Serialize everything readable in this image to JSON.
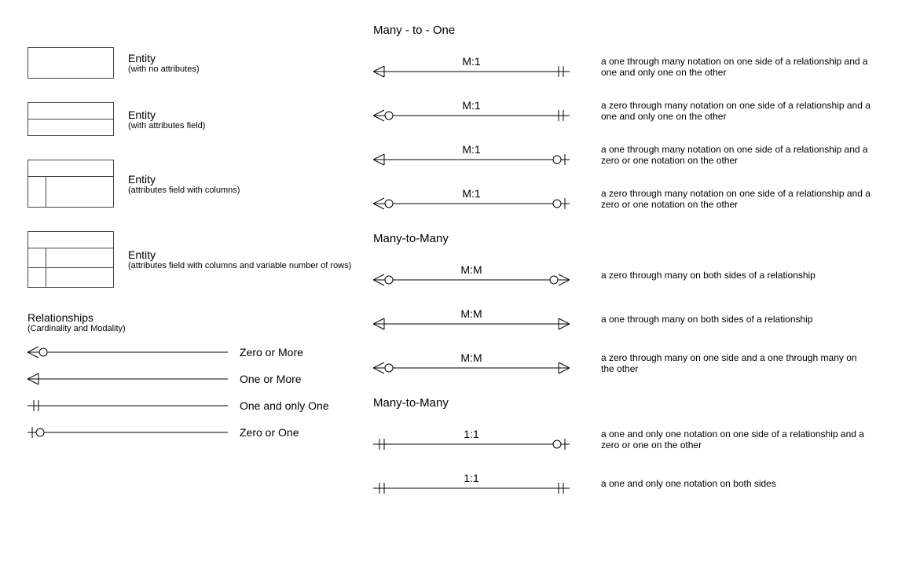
{
  "entities": [
    {
      "title": "Entity",
      "sub": "(with no attributes)"
    },
    {
      "title": "Entity",
      "sub": "(with attributes field)"
    },
    {
      "title": "Entity",
      "sub": "(attributes field with columns)"
    },
    {
      "title": "Entity",
      "sub": "(attributes field with columns and variable number of rows)"
    }
  ],
  "relationshipsHeader": {
    "title": "Relationships",
    "sub": "(Cardinality and Modality)"
  },
  "legend": [
    {
      "label": "Zero or More"
    },
    {
      "label": "One or More"
    },
    {
      "label": "One and only One"
    },
    {
      "label": "Zero or One"
    }
  ],
  "sections": {
    "m1": "Many - to - One",
    "mm": "Many-to-Many",
    "oo": "Many-to-Many"
  },
  "m1": [
    {
      "ratio": "M:1",
      "desc": "a one through many notation on one side of a relationship and a one and only one on the other"
    },
    {
      "ratio": "M:1",
      "desc": "a zero through many notation on one side of a relationship and a one and only one on the other"
    },
    {
      "ratio": "M:1",
      "desc": "a one through many notation on one side of a relationship and a zero or one notation on the other"
    },
    {
      "ratio": "M:1",
      "desc": "a zero through many notation on one side of a relationship and a zero or one notation on the other"
    }
  ],
  "mm": [
    {
      "ratio": "M:M",
      "desc": "a zero through many on both sides of a relationship"
    },
    {
      "ratio": "M:M",
      "desc": "a one through many on both sides of a relationship"
    },
    {
      "ratio": "M:M",
      "desc": "a zero through many on one side and a one through many on the other"
    }
  ],
  "oo": [
    {
      "ratio": "1:1",
      "desc": "a one and only one notation on one side of a relationship and a zero or one on the other"
    },
    {
      "ratio": "1:1",
      "desc": "a one and only one notation on both sides"
    }
  ]
}
